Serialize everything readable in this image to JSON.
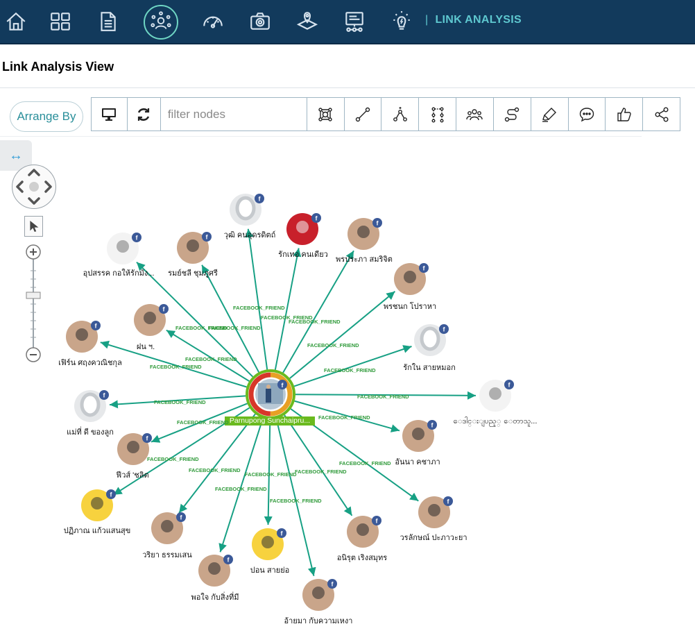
{
  "nav": {
    "icons": [
      "home-icon",
      "dashboard-grid-icon",
      "document-icon",
      "link-analysis-icon",
      "speedometer-icon",
      "camera-icon",
      "map-location-icon",
      "presentation-board-icon",
      "lightbulb-icon"
    ],
    "active": "link-analysis-icon",
    "breadcrumb_separator": "|",
    "breadcrumb": "LINK ANALYSIS"
  },
  "page": {
    "title": "Link Analysis View"
  },
  "toolbar": {
    "arrange_label": "Arrange By",
    "filter_placeholder": "filter nodes",
    "tools": [
      "monitor-icon",
      "refresh-icon",
      "network-node-icon",
      "link-line-icon",
      "hierarchy-icon",
      "tree-layout-icon",
      "group-icon",
      "path-icon",
      "highlighter-icon",
      "comment-icon",
      "like-icon",
      "share-icon"
    ]
  },
  "graph": {
    "center": {
      "label": "Parnupong Sunchaipru...",
      "badge": "f"
    },
    "edge_label": "FACEBOOK_FRIEND",
    "badge_text": "f",
    "nodes": [
      {
        "label": "อุปสรรค กอให้รักมัง...",
        "avatar": "drawing"
      },
      {
        "label": "รมย์ชลี ชุมภูศรี",
        "avatar": "photo"
      },
      {
        "label": "วุฒิ คนอุดรดิตถ์",
        "avatar": "placeholder"
      },
      {
        "label": "รักเทอ คนเดียว",
        "avatar": "logo"
      },
      {
        "label": "พรประภา สมริจิต",
        "avatar": "photo"
      },
      {
        "label": "พรชนก โปราหา",
        "avatar": "photo"
      },
      {
        "label": "รักใน สายหมอก",
        "avatar": "placeholder"
      },
      {
        "label": "ေဒါင္းျပည့္ ေတာသူ...",
        "avatar": "drawing"
      },
      {
        "label": "อันนา คชาภา",
        "avatar": "photo"
      },
      {
        "label": "วรลักษณ์ ปะภาวะยา",
        "avatar": "photo"
      },
      {
        "label": "อนิรุต เริงสมุทร",
        "avatar": "photo"
      },
      {
        "label": "อ้ายมา กับความเหงา",
        "avatar": "photo"
      },
      {
        "label": "ปอน สายย่อ",
        "avatar": "cartoon"
      },
      {
        "label": "พอใจ กับสิ่งที่มี",
        "avatar": "photo"
      },
      {
        "label": "วริยา ธรรมเสน",
        "avatar": "photo"
      },
      {
        "label": "ปฏิภาณ แก้วแสนสุข",
        "avatar": "cartoon"
      },
      {
        "label": "ฟีวส์ 'ชลิต",
        "avatar": "photo"
      },
      {
        "label": "แม่ที่ ดี ของลูก",
        "avatar": "placeholder"
      },
      {
        "label": "เฟิร์น ศฤงควณิชกุล",
        "avatar": "photo"
      },
      {
        "label": "ฝน ฯ.",
        "avatar": "photo"
      }
    ]
  },
  "colors": {
    "topbar": "#123a5c",
    "accent": "#5ec8d0",
    "edge": "#17a084",
    "edge_label": "#2f9a3a",
    "center_label_bg": "#6aba1e",
    "badge": "#3b5998"
  }
}
